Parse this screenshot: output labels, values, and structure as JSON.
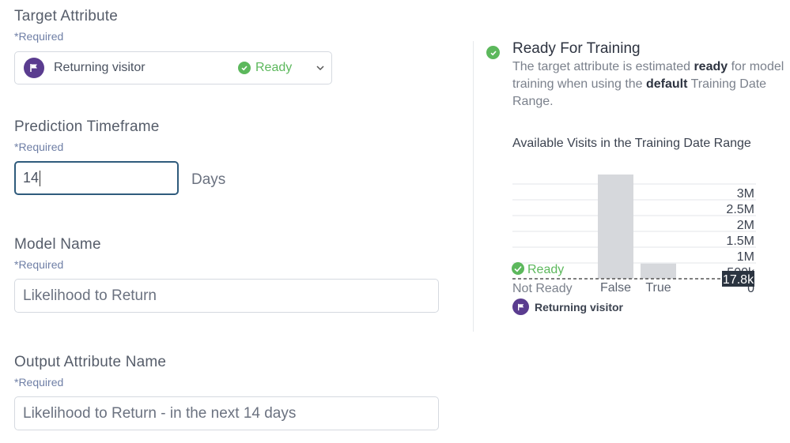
{
  "form": {
    "target_attribute": {
      "label": "Target Attribute",
      "required": "*Required",
      "value": "Returning visitor",
      "status": "Ready"
    },
    "prediction_timeframe": {
      "label": "Prediction Timeframe",
      "required": "*Required",
      "value": "14",
      "unit": "Days"
    },
    "model_name": {
      "label": "Model Name",
      "required": "*Required",
      "value": "Likelihood to Return"
    },
    "output_attribute": {
      "label": "Output Attribute Name",
      "required": "*Required",
      "value": "Likelihood to Return - in the next 14 days"
    }
  },
  "readiness": {
    "title": "Ready For Training",
    "desc_part1": "The target attribute is estimated ",
    "desc_bold1": "ready",
    "desc_part2": " for model training when using the ",
    "desc_bold2": "default",
    "desc_part3": " Training Date Range."
  },
  "chart_data": {
    "type": "bar",
    "title": "Available Visits in the Training Date Range",
    "categories": [
      "False",
      "True"
    ],
    "values": [
      3300000,
      480000
    ],
    "ylim": [
      0,
      3000000
    ],
    "yticks": [
      "0",
      "500k",
      "1M",
      "1.5M",
      "2M",
      "2.5M",
      "3M"
    ],
    "threshold": {
      "value": "17.8k",
      "ready_label": "Ready",
      "not_ready_label": "Not Ready"
    },
    "legend": "Returning visitor",
    "grid": true
  },
  "colors": {
    "accent_ready": "#5cb85c",
    "flag_purple": "#5a3c8f",
    "input_focus": "#2f5b7c",
    "bar": "#d6d8dc"
  },
  "icons": {
    "attribute": "flag-icon",
    "ready": "check-circle-icon",
    "dropdown": "chevron-down-icon"
  }
}
